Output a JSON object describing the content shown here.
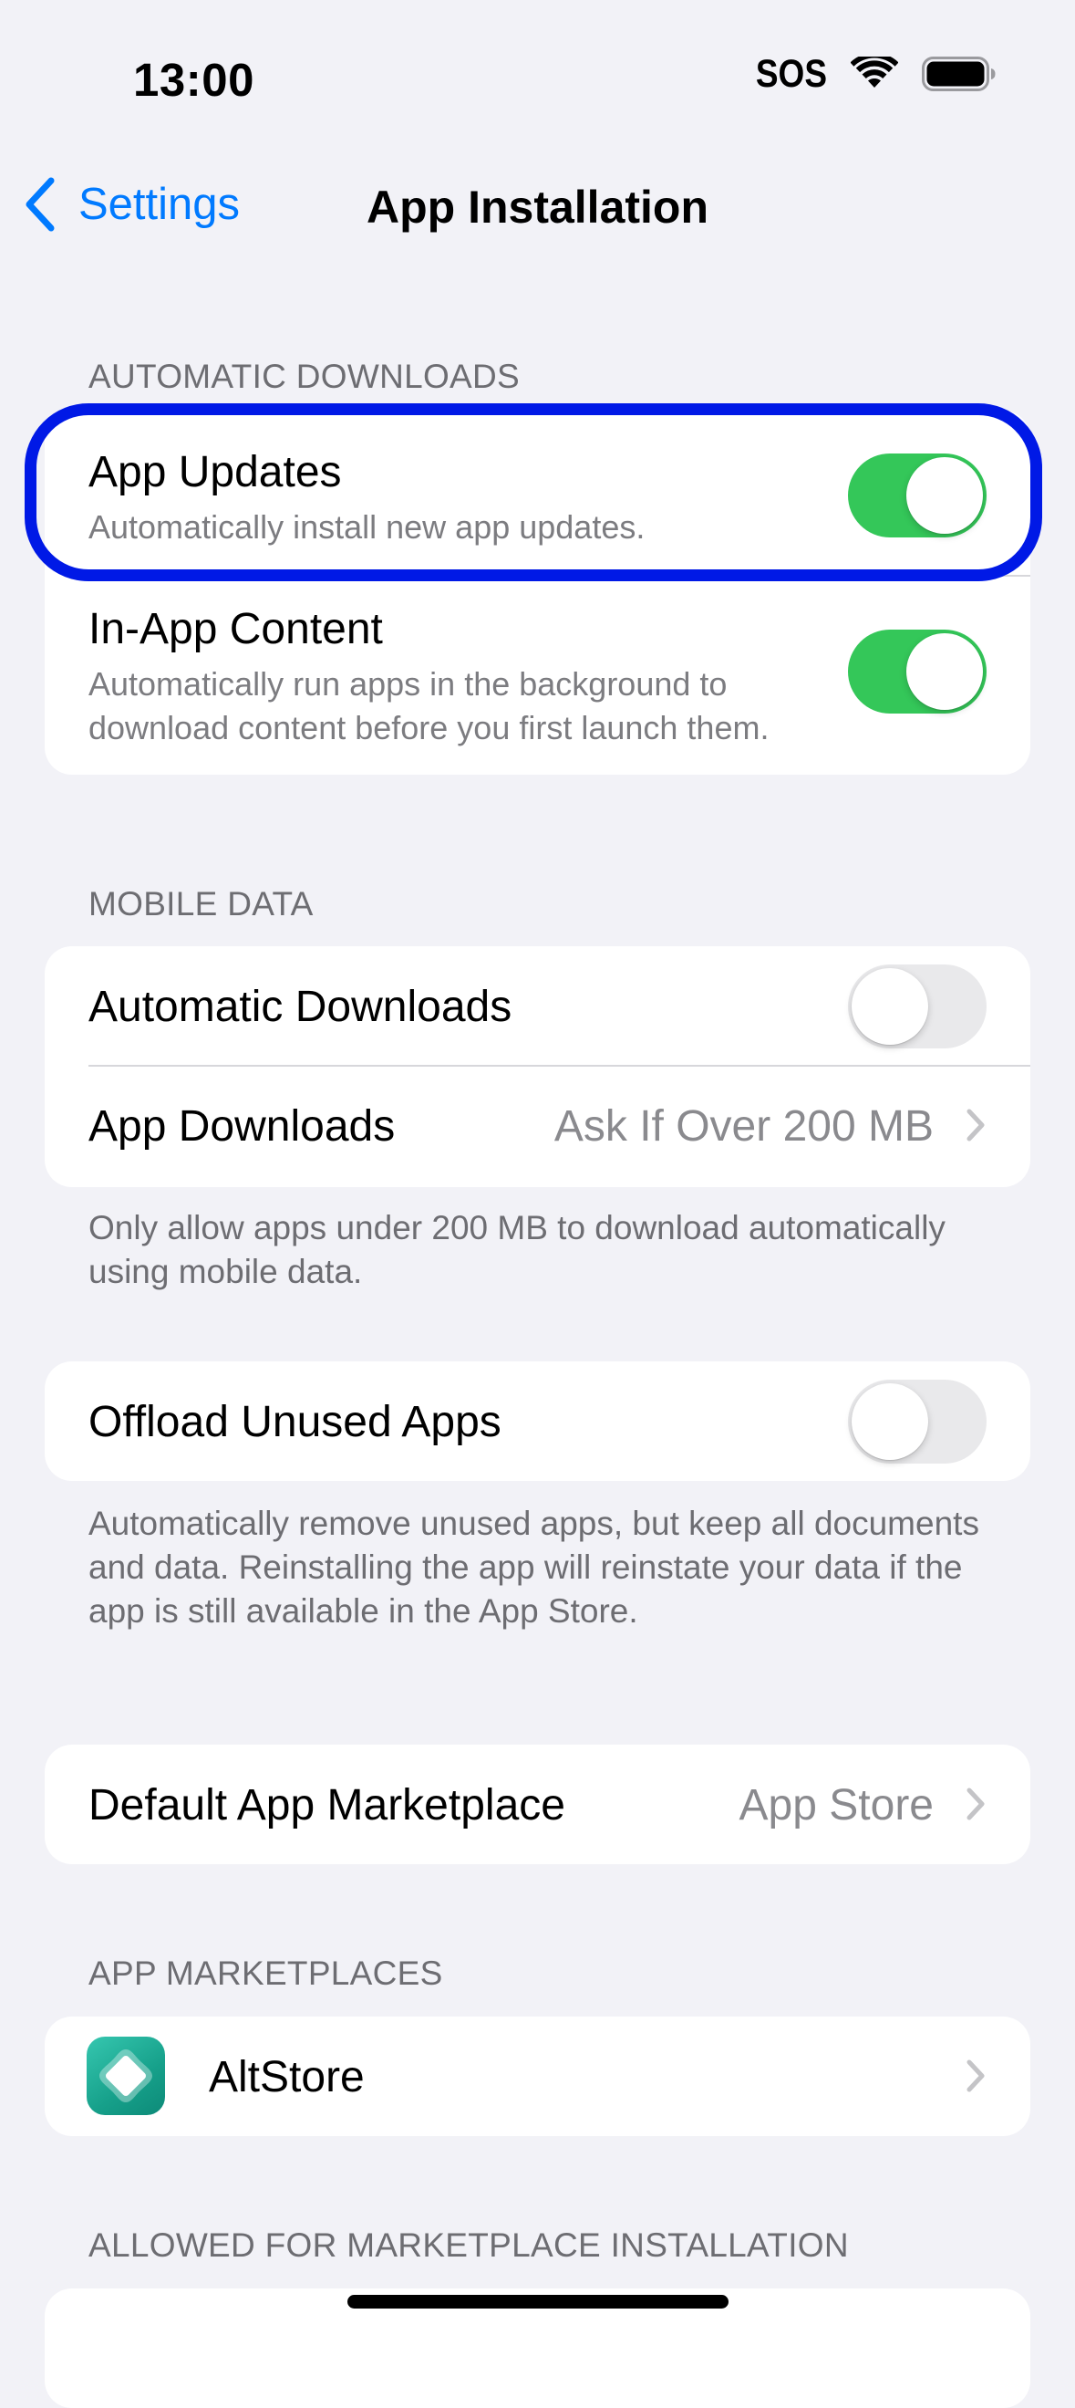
{
  "status_bar": {
    "time": "13:00",
    "carrier": "SOS"
  },
  "nav": {
    "back_label": "Settings",
    "title": "App Installation"
  },
  "automatic_downloads": {
    "header": "AUTOMATIC DOWNLOADS",
    "rows": [
      {
        "title": "App Updates",
        "subtitle": "Automatically install new app updates.",
        "enabled": true
      },
      {
        "title": "In-App Content",
        "subtitle": "Automatically run apps in the background to download content before you first launch them.",
        "enabled": true
      }
    ]
  },
  "mobile_data": {
    "header": "MOBILE DATA",
    "automatic_downloads": {
      "title": "Automatic Downloads",
      "enabled": false
    },
    "app_downloads": {
      "title": "App Downloads",
      "value": "Ask If Over 200 MB"
    },
    "footer": "Only allow apps under 200 MB to download automatically using mobile data."
  },
  "offload": {
    "title": "Offload Unused Apps",
    "enabled": false,
    "footer": "Automatically remove unused apps, but keep all documents and data. Reinstalling the app will reinstate your data if the app is still available in the App Store."
  },
  "default_marketplace": {
    "title": "Default App Marketplace",
    "value": "App Store"
  },
  "app_marketplaces": {
    "header": "APP MARKETPLACES",
    "items": [
      {
        "name": "AltStore",
        "icon": "altstore-icon"
      }
    ]
  },
  "allowed_marketplace": {
    "header": "ALLOWED FOR MARKETPLACE INSTALLATION"
  },
  "colors": {
    "accent": "#007aff",
    "toggle_on": "#34c759",
    "toggle_off": "#e9e9eb",
    "highlight": "#0019e6",
    "background": "#f2f2f7"
  }
}
